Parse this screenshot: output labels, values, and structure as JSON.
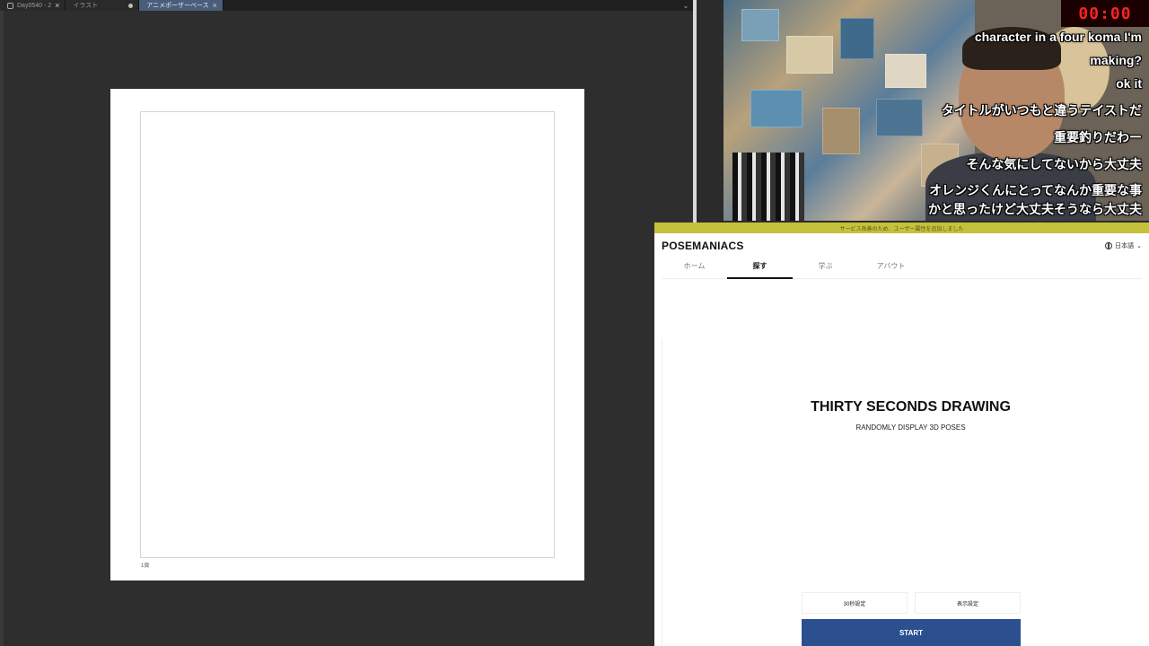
{
  "app": {
    "tabs": [
      {
        "label": "Day0540 - 2"
      },
      {
        "label": "イラスト"
      },
      {
        "label": "アニメポーザーベース"
      }
    ],
    "page_number": "1頁"
  },
  "stream": {
    "timer": "00:00",
    "chat": [
      "character in a four koma I'm",
      "making?",
      "ok it",
      "タイトルがいつもと違うテイストだ",
      "重要釣りだわー",
      "そんな気にしてないから大丈夫",
      "オレンジくんにとってなんか重要な事かと思ったけど大丈夫そうなら大丈夫"
    ]
  },
  "site": {
    "notice": "サービス改善のため、ユーザー属性を追加しました",
    "logo": "POSEMANIACS",
    "language": "日本語",
    "nav": [
      {
        "label": "ホーム",
        "active": false
      },
      {
        "label": "探す",
        "active": true
      },
      {
        "label": "学ぶ",
        "active": false
      },
      {
        "label": "アバウト",
        "active": false
      }
    ],
    "title": "THIRTY SECONDS DRAWING",
    "subtitle": "RANDOMLY DISPLAY 3D POSES",
    "btn_time": "30秒設定",
    "btn_display": "表示設定",
    "start": "START",
    "accent": "#2b4f8f"
  }
}
